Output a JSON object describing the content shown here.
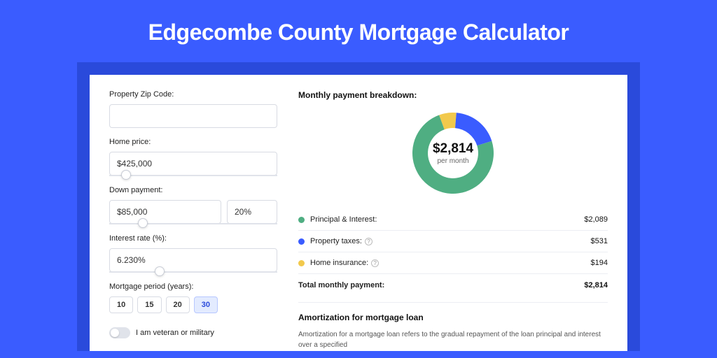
{
  "title": "Edgecombe County Mortgage Calculator",
  "form": {
    "zip_label": "Property Zip Code:",
    "zip_value": "",
    "price_label": "Home price:",
    "price_value": "$425,000",
    "price_slider_pct": 10,
    "dp_label": "Down payment:",
    "dp_value": "$85,000",
    "dp_pct_value": "20%",
    "dp_slider_pct": 20,
    "rate_label": "Interest rate (%):",
    "rate_value": "6.230%",
    "rate_slider_pct": 30,
    "period_label": "Mortgage period (years):",
    "periods": [
      "10",
      "15",
      "20",
      "30"
    ],
    "period_active": "30",
    "veteran_label": "I am veteran or military"
  },
  "breakdown": {
    "title": "Monthly payment breakdown:",
    "center_amount": "$2,814",
    "center_sub": "per month",
    "items": [
      {
        "label": "Principal & Interest:",
        "value": "$2,089",
        "color": "#4fae82",
        "info": false
      },
      {
        "label": "Property taxes:",
        "value": "$531",
        "color": "#3a5cff",
        "info": true
      },
      {
        "label": "Home insurance:",
        "value": "$194",
        "color": "#f2c94c",
        "info": true
      }
    ],
    "total_label": "Total monthly payment:",
    "total_value": "$2,814"
  },
  "amort": {
    "title": "Amortization for mortgage loan",
    "text": "Amortization for a mortgage loan refers to the gradual repayment of the loan principal and interest over a specified"
  },
  "chart_data": {
    "type": "pie",
    "title": "Monthly payment breakdown",
    "series": [
      {
        "name": "Principal & Interest",
        "value": 2089,
        "color": "#4fae82"
      },
      {
        "name": "Property taxes",
        "value": 531,
        "color": "#3a5cff"
      },
      {
        "name": "Home insurance",
        "value": 194,
        "color": "#f2c94c"
      }
    ],
    "total": 2814,
    "inner_radius_ratio": 0.62
  }
}
